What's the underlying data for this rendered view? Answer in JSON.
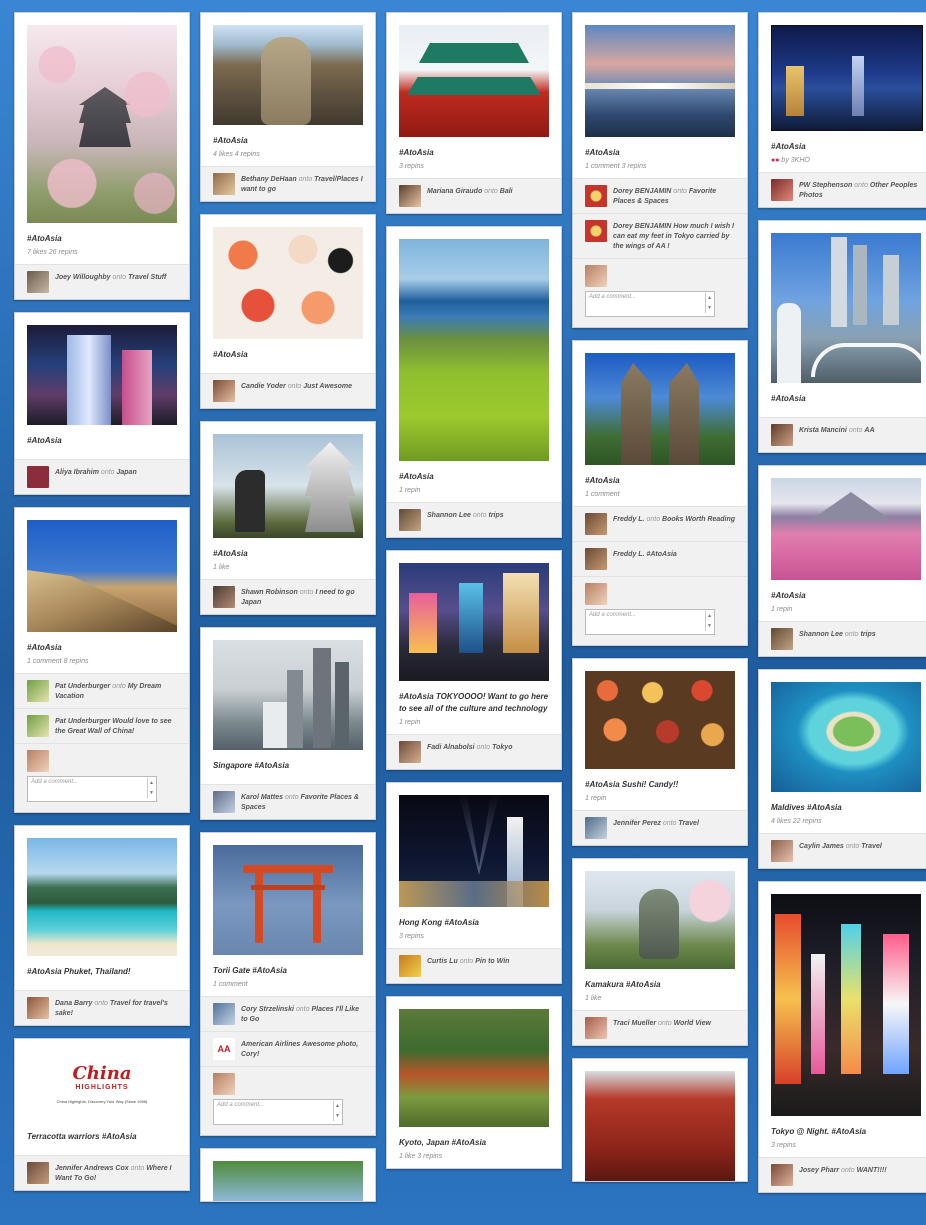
{
  "tag": "#AtoAsia",
  "comment_placeholder": "Add a comment...",
  "china_logo": {
    "brand": "China",
    "brand2": "HIGHLIGHTS",
    "tagline": "China Highlights, Discovery Your Way (Since 1998)"
  },
  "columns": [
    {
      "pins": [
        {
          "desc": "#AtoAsia",
          "stats": "7 likes   26 repins",
          "attribution": [
            {
              "name": "Joey Willoughby",
              "onto": "onto",
              "board": "Travel Stuff"
            }
          ]
        },
        {
          "desc": "#AtoAsia",
          "stats": "",
          "attribution": [
            {
              "name": "Aliya Ibrahim",
              "onto": "onto",
              "board": "Japan"
            }
          ]
        },
        {
          "desc": "#AtoAsia",
          "stats": "1 comment   8 repins",
          "attribution": [
            {
              "name": "Pat Underburger",
              "onto": "onto",
              "board": "My Dream Vacation"
            },
            {
              "name": "Pat Underburger",
              "onto": "",
              "board": "Would love to see the Great Wall of China!"
            }
          ],
          "comment": true
        },
        {
          "desc": "#AtoAsia Phuket, Thailand!",
          "stats": "",
          "attribution": [
            {
              "name": "Dana Barry",
              "onto": "onto",
              "board": "Travel for travel's sake!"
            }
          ]
        },
        {
          "desc": "Terracotta warriors #AtoAsia",
          "stats": "",
          "attribution": [
            {
              "name": "Jennifer Andrews Cox",
              "onto": "onto",
              "board": "Where I Want To Go!"
            }
          ]
        }
      ]
    },
    {
      "pins": [
        {
          "desc": "#AtoAsia",
          "stats": "4 likes   4 repins",
          "attribution": [
            {
              "name": "Bethany DeHaan",
              "onto": "onto",
              "board": "Travel/Places I want to go"
            }
          ]
        },
        {
          "desc": "#AtoAsia",
          "stats": "",
          "attribution": [
            {
              "name": "Candie Yoder",
              "onto": "onto",
              "board": "Just Awesome"
            }
          ]
        },
        {
          "desc": "#AtoAsia",
          "stats": "1 like",
          "attribution": [
            {
              "name": "Shawn Robinson",
              "onto": "onto",
              "board": "I need to go Japan"
            }
          ]
        },
        {
          "desc": "Singapore #AtoAsia",
          "stats": "",
          "attribution": [
            {
              "name": "Karol Mattes",
              "onto": "onto",
              "board": "Favorite Places & Spaces"
            }
          ]
        },
        {
          "desc": "Torii Gate #AtoAsia",
          "stats": "1 comment",
          "attribution": [
            {
              "name": "Cory Strzelinski",
              "onto": "onto",
              "board": "Places I'll Like to Go"
            },
            {
              "name": "American Airlines",
              "onto": "",
              "board": "Awesome photo, Cory!"
            }
          ],
          "comment": true
        }
      ]
    },
    {
      "pins": [
        {
          "desc": "#AtoAsia",
          "stats": "3 repins",
          "attribution": [
            {
              "name": "Mariana Giraudo",
              "onto": "onto",
              "board": "Bali"
            }
          ]
        },
        {
          "desc": "#AtoAsia",
          "stats": "1 repin",
          "attribution": [
            {
              "name": "Shannon Lee",
              "onto": "onto",
              "board": "trips"
            }
          ]
        },
        {
          "desc": "#AtoAsia TOKYOOOO! Want to go here to see all of the culture and technology",
          "stats": "1 repin",
          "attribution": [
            {
              "name": "Fadi Alnabolsi",
              "onto": "onto",
              "board": "Tokyo"
            }
          ]
        },
        {
          "desc": "Hong Kong #AtoAsia",
          "stats": "3 repins",
          "attribution": [
            {
              "name": "Curtis Lu",
              "onto": "onto",
              "board": "Pin to Win"
            }
          ]
        },
        {
          "desc": "Kyoto, Japan #AtoAsia",
          "stats": "1 like   3 repins",
          "attribution": []
        }
      ]
    },
    {
      "pins": [
        {
          "desc": "#AtoAsia",
          "stats": "1 comment   3 repins",
          "attribution": [
            {
              "name": "Dorey BENJAMIN",
              "onto": "onto",
              "board": "Favorite Places & Spaces"
            },
            {
              "name": "Dorey BENJAMIN",
              "onto": "",
              "board": "How much I wish I can eat my feet in Tokyo carried by the wings of AA !"
            }
          ],
          "comment": true
        },
        {
          "desc": "#AtoAsia",
          "stats": "1 comment",
          "attribution": [
            {
              "name": "Freddy L.",
              "onto": "onto",
              "board": "Books Worth Reading"
            },
            {
              "name": "Freddy L.",
              "onto": "",
              "board": "#AtoAsia"
            }
          ],
          "comment": true
        },
        {
          "desc": "#AtoAsia Sushi! Candy!!",
          "stats": "1 repin",
          "attribution": [
            {
              "name": "Jennifer Perez",
              "onto": "onto",
              "board": "Travel"
            }
          ]
        },
        {
          "desc": "Kamakura #AtoAsia",
          "stats": "1 like",
          "attribution": [
            {
              "name": "Traci Mueller",
              "onto": "onto",
              "board": "World View"
            }
          ]
        },
        {
          "desc": "",
          "stats": "",
          "attribution": []
        }
      ]
    },
    {
      "pins": [
        {
          "desc": "#AtoAsia",
          "stats": "by 3KHO",
          "attribution": [
            {
              "name": "PW Stephenson",
              "onto": "onto",
              "board": "Other Peoples Photos"
            }
          ]
        },
        {
          "desc": "#AtoAsia",
          "stats": "",
          "attribution": [
            {
              "name": "Krista Mancini",
              "onto": "onto",
              "board": "AA"
            }
          ]
        },
        {
          "desc": "#AtoAsia",
          "stats": "1 repin",
          "attribution": [
            {
              "name": "Shannon Lee",
              "onto": "onto",
              "board": "trips"
            }
          ]
        },
        {
          "desc": "Maldives #AtoAsia",
          "stats": "4 likes   22 repins",
          "attribution": [
            {
              "name": "Caylin James",
              "onto": "onto",
              "board": "Travel"
            }
          ]
        },
        {
          "desc": "Tokyo @ Night. #AtoAsia",
          "stats": "3 repins",
          "attribution": [
            {
              "name": "Josey Pharr",
              "onto": "onto",
              "board": "WANT!!!!"
            }
          ]
        }
      ]
    }
  ],
  "colors": {
    "background": "#2a6fb6",
    "card": "#ffffff",
    "attr_bg": "#f1f1f1"
  }
}
